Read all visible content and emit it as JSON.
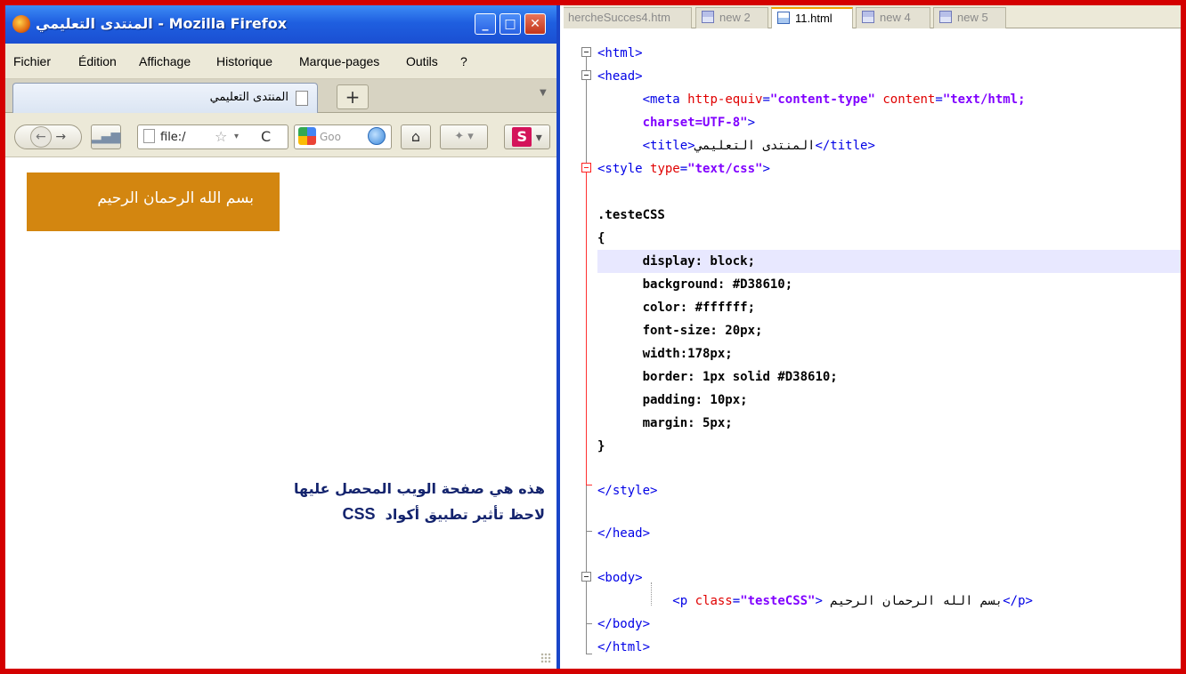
{
  "firefox": {
    "title": "المنتدى التعليمي - Mozilla Firefox",
    "window_buttons": {
      "minimize": "_",
      "maximize": "□",
      "close": "✕"
    },
    "menu": [
      "Fichier",
      "Édition",
      "Affichage",
      "Historique",
      "Marque-pages",
      "Outils",
      "?"
    ],
    "tab": {
      "label": "المنتدى التعليمي",
      "new_tab": "+"
    },
    "navbar": {
      "back": "←",
      "forward": "→",
      "url": "file:/",
      "star": "☆",
      "dropdown": "▾",
      "reload": "C",
      "search_placeholder": "Goo",
      "home": "⌂",
      "ext_dropdown": "▾",
      "s_badge": "S",
      "s_dropdown": "▾"
    },
    "content": {
      "styled_paragraph": "بسم الله الرحمان الرحيم",
      "note_line1": "هذه هي صفحة الويب المحصل عليها",
      "note_line2": "لاحظ تأثير تطبيق أكواد",
      "note_css": "CSS"
    }
  },
  "editor": {
    "tabs": [
      {
        "label": "hercheSucces4.htm",
        "active": false
      },
      {
        "label": "new 2",
        "active": false
      },
      {
        "label": "11.html",
        "active": true
      },
      {
        "label": "new 4",
        "active": false
      },
      {
        "label": "new 5",
        "active": false
      }
    ],
    "code": {
      "l1": "<html>",
      "l2": "<head>",
      "l3_tag": "<meta",
      "l3_attr1": "http-equiv",
      "l3_eq1": "=",
      "l3_val1": "\"content-type\"",
      "l3_attr2": "content",
      "l3_eq2": "=",
      "l3_val2": "\"text/html;",
      "l4_val": "charset=UTF-8\"",
      "l4_close": ">",
      "l5_open": "<title>",
      "l5_text": "المنتدى التعليمي",
      "l5_close": "</title>",
      "l6_tag": "<style",
      "l6_attr": "type",
      "l6_eq": "=",
      "l6_val": "\"text/css\"",
      "l6_close": ">",
      "l8": ".testeCSS",
      "l9": "{",
      "l10": "display: block;",
      "l11": "background: #D38610;",
      "l12": "color: #ffffff;",
      "l13": "font-size: 20px;",
      "l14": "width:178px;",
      "l15": "border: 1px solid #D38610;",
      "l16": "padding: 10px;",
      "l17": "margin: 5px;",
      "l18": "}",
      "l20": "</style>",
      "l22": "</head>",
      "l24": "<body>",
      "l25_tag": "<p",
      "l25_attr": "class",
      "l25_eq": "=",
      "l25_val": "\"testeCSS\"",
      "l25_gt": ">",
      "l25_text": "بسم الله الرحمان الرحيم",
      "l25_close": "</p>",
      "l26": "</body>",
      "l27": "</html>"
    }
  },
  "colors": {
    "accent": "#D38610",
    "frame": "#D40000",
    "note_text": "#14246E"
  }
}
